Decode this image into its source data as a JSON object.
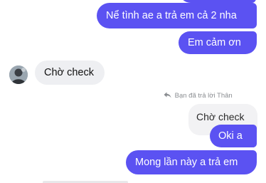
{
  "messages": [
    {
      "id": "m1",
      "side": "out",
      "text": "Nể tình ae a trả em cả 2 nha"
    },
    {
      "id": "m2",
      "side": "out",
      "text": "Em cảm ơn"
    },
    {
      "id": "m3",
      "side": "in",
      "text": "Chờ check"
    },
    {
      "id": "m4",
      "side": "out",
      "reply_note": "Bạn đã trả lời Thân",
      "quoted_text": "Chờ check",
      "text": "Oki a"
    },
    {
      "id": "m5",
      "side": "out",
      "text": "Mong lần này a trả em"
    }
  ],
  "icons": {
    "reply": "reply-arrow-icon",
    "avatar": "user-avatar"
  },
  "colors": {
    "outgoing_bubble": "#5b52f2",
    "incoming_bubble": "#eeeff2",
    "quoted_bubble": "#f2f2f4",
    "reply_note_text": "#8a8d91"
  }
}
